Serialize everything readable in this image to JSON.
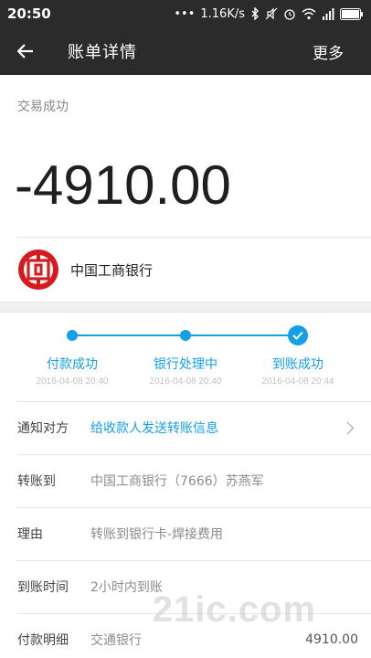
{
  "status_bar": {
    "time": "20:50",
    "network_speed": "1.16K/s",
    "icons": [
      "dots-icon",
      "bluetooth-icon",
      "mute-icon",
      "alarm-icon",
      "wifi-icon",
      "signal-icon",
      "battery-icon"
    ]
  },
  "header": {
    "back_icon": "back-arrow-icon",
    "title": "账单详情",
    "more_label": "更多"
  },
  "summary": {
    "status": "交易成功",
    "amount": "-4910.00",
    "bank_logo_icon": "icbc-logo",
    "bank_name": "中国工商银行"
  },
  "progress": {
    "color": "#13a0e8",
    "steps": [
      {
        "label": "付款成功",
        "time": "2016-04-08 20:40"
      },
      {
        "label": "银行处理中",
        "time": "2016-04-08 20:40"
      },
      {
        "label": "到账成功",
        "time": "2016-04-08 20:44"
      }
    ]
  },
  "details": [
    {
      "key": "通知对方",
      "value": "给收款人发送转账信息",
      "link": true
    },
    {
      "key": "转账到",
      "value": "中国工商银行（7666）苏燕军"
    },
    {
      "key": "理由",
      "value": "转账到银行卡-焊接费用"
    },
    {
      "key": "到账时间",
      "value": "2小时内到账"
    },
    {
      "key": "付款明细",
      "value": "交通银行",
      "extra": "4910.00"
    }
  ],
  "watermark": "21ic.com"
}
